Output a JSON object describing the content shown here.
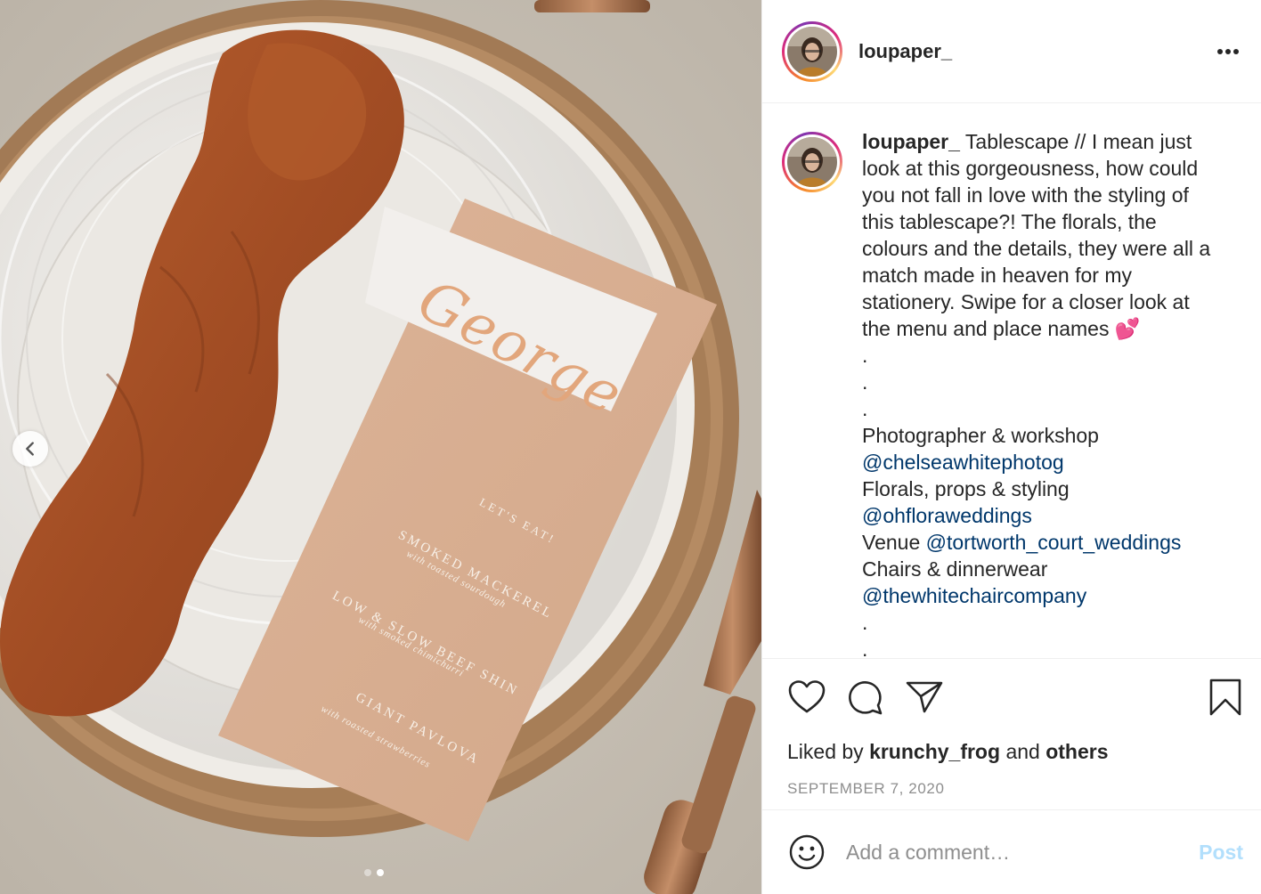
{
  "post": {
    "author": "loupaper_",
    "caption_lines": [
      "Tablescape // I mean just",
      "look at this gorgeousness, how could",
      "you not fall in love with the styling of",
      "this tablescape?! The florals, the",
      "colours and the details, they were all a",
      "match made in heaven for my",
      "stationery. Swipe for a closer look at",
      "the menu and place names 💕",
      ".",
      ".",
      ".",
      "Photographer & workshop"
    ],
    "mention_photographer": "@chelseawhitephotog",
    "florals_label": "Florals, props & styling",
    "mention_florals": "@ohfloraweddings",
    "venue_label": "Venue",
    "mention_venue": "@tortworth_court_weddings",
    "chairs_label": "Chairs & dinnerwear",
    "mention_chairs": "@thewhitechaircompany",
    "trailing_dots": [
      ".",
      "."
    ],
    "liked_by_prefix": "Liked by",
    "liked_by_user": "krunchy_frog",
    "liked_by_and": "and",
    "liked_by_others": "others",
    "date": "SEPTEMBER 7, 2020"
  },
  "comment_box": {
    "placeholder": "Add a comment…",
    "post_label": "Post"
  },
  "photo": {
    "place_card_name": "George",
    "menu_heading": "LET'S EAT!",
    "menu_items": [
      {
        "dish": "SMOKED MACKEREL",
        "detail": "with toasted sourdough"
      },
      {
        "dish": "LOW & SLOW BEEF SHIN",
        "detail": "with smoked chimichurri"
      },
      {
        "dish": "GIANT PAVLOVA",
        "detail": "with roasted strawberries"
      }
    ],
    "carousel": {
      "count": 2,
      "active": 2
    }
  },
  "icons": {
    "more": "more-horizontal-icon",
    "like": "heart-icon",
    "comment": "comment-icon",
    "share": "share-paper-plane-icon",
    "save": "bookmark-icon",
    "emoji": "smiley-face-icon",
    "prev": "chevron-left-icon"
  },
  "colors": {
    "mention": "#00376b",
    "post_button_disabled": "#b2dffc",
    "muted_text": "#8e8e8e"
  }
}
